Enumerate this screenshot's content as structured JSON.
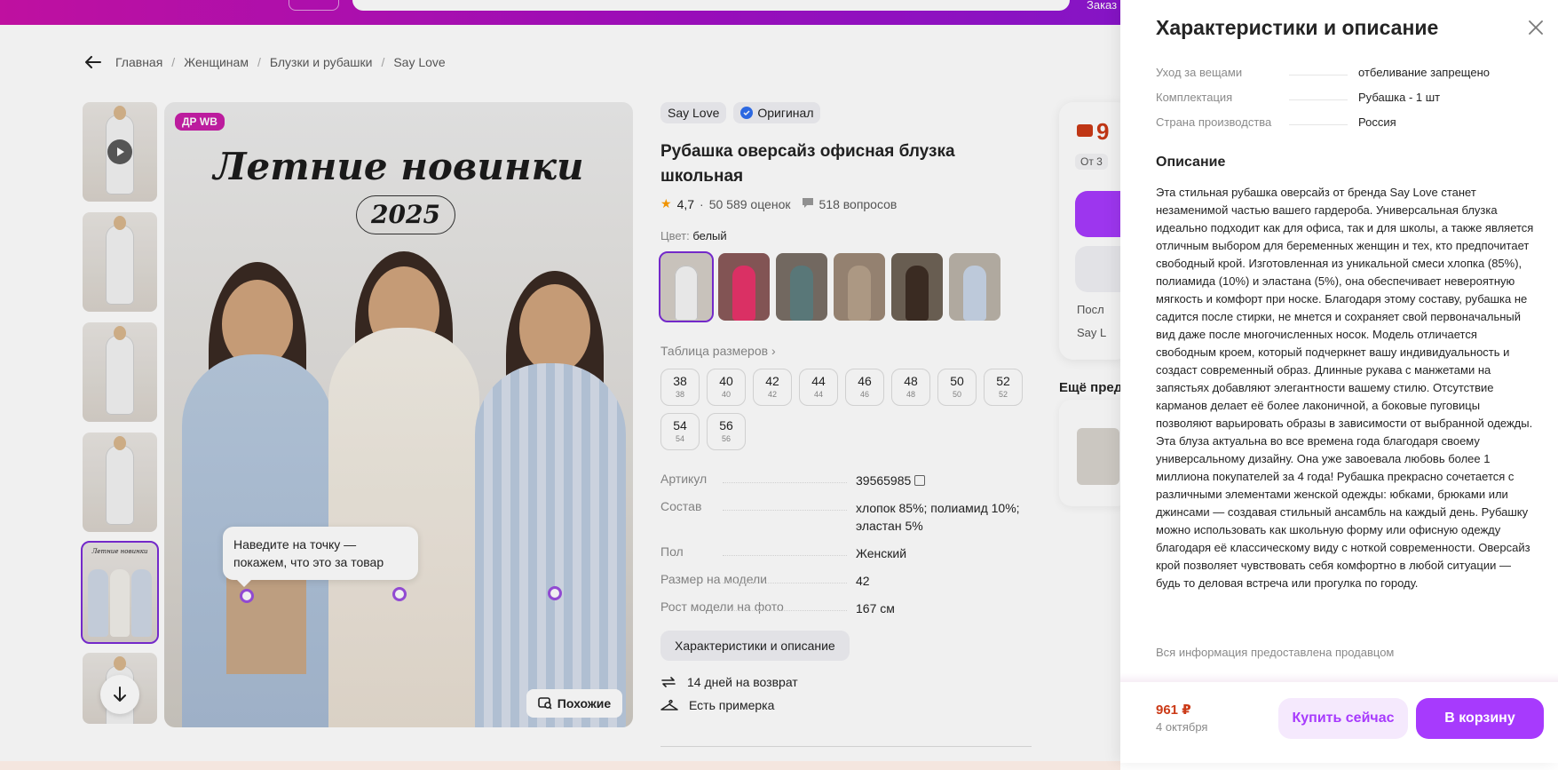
{
  "header": {
    "right_text": "Заказ"
  },
  "breadcrumb": [
    "Главная",
    "Женщинам",
    "Блузки и рубашки",
    "Say Love"
  ],
  "gallery": {
    "badge": "ДР WB",
    "promo_title": "Летние новинки",
    "promo_year": "2025",
    "thumb_mini_title": "Летние новинки",
    "tooltip": "Наведите на точку — покажем, что это за товар",
    "similar_label": "Похожие"
  },
  "product": {
    "brand": "Say Love",
    "original_label": "Оригинал",
    "title": "Рубашка оверсайз офисная блузка школьная",
    "rating": "4,7",
    "rating_sep": "·",
    "reviews": "50 589 оценок",
    "questions": "518 вопросов",
    "color_label": "Цвет:",
    "color_value": "белый",
    "size_table_link": "Таблица размеров",
    "sizes": [
      {
        "main": "38",
        "sub": "38"
      },
      {
        "main": "40",
        "sub": "40"
      },
      {
        "main": "42",
        "sub": "42"
      },
      {
        "main": "44",
        "sub": "44"
      },
      {
        "main": "46",
        "sub": "46"
      },
      {
        "main": "48",
        "sub": "48"
      },
      {
        "main": "50",
        "sub": "50"
      },
      {
        "main": "52",
        "sub": "52"
      },
      {
        "main": "54",
        "sub": "54"
      },
      {
        "main": "56",
        "sub": "56"
      }
    ],
    "specs": [
      {
        "k": "Артикул",
        "v": "39565985"
      },
      {
        "k": "Состав",
        "v": "хлопок 85%; полиамид 10%; эластан 5%"
      },
      {
        "k": "Пол",
        "v": "Женский"
      },
      {
        "k": "Размер на модели",
        "v": "42"
      },
      {
        "k": "Рост модели на фото",
        "v": "167 см"
      }
    ],
    "characteristics_button": "Характеристики и описание",
    "perk_return": "14 дней на возврат",
    "perk_fitting": "Есть примерка"
  },
  "buybox": {
    "price_peek": "9",
    "tag_peek": "От 3",
    "line1_peek": "Посл",
    "line2_peek": "Say L",
    "more_title": "Ещё пред"
  },
  "panel": {
    "title": "Характеристики и описание",
    "rows": [
      {
        "k": "Уход за вещами",
        "v": "отбеливание запрещено"
      },
      {
        "k": "Комплектация",
        "v": "Рубашка - 1 шт"
      },
      {
        "k": "Страна производства",
        "v": "Россия"
      }
    ],
    "description_title": "Описание",
    "description": "Эта стильная рубашка оверсайз от бренда Say Love станет незаменимой частью вашего гардероба. Универсальная блузка идеально подходит как для офиса, так и для школы, а также является отличным выбором для беременных женщин и тех, кто предпочитает свободный крой. Изготовленная из уникальной смеси хлопка (85%), полиамида (10%) и эластана (5%), она обеспечивает невероятную мягкость и комфорт при носке. Благодаря этому составу, рубашка не садится после стирки, не мнется и сохраняет свой первоначальный вид даже после многочисленных носок. Модель отличается свободным кроем, который подчеркнет вашу индивидуальность и создаст современный образ. Длинные рукава с манжетами на запястьях добавляют элегантности вашему стилю. Отсутствие карманов делает её более лаконичной, а боковые пуговицы позволяют варьировать образы в зависимости от выбранной одежды. Эта блуза актуальна во все времена года благодаря своему универсальному дизайну. Она уже завоевала любовь более 1 миллиона покупателей за 4 года! Рубашка прекрасно сочетается с различными элементами женской одежды: юбками, брюками или джинсами — создавая стильный ансамбль на каждый день. Рубашку можно использовать как школьную форму или офисную одежду благодаря её классическому виду с ноткой современности. Оверсайз крой позволяет чувствовать себя комфортно в любой ситуации — будь то деловая встреча или прогулка по городу.",
    "seller_note": "Вся информация предоставлена продавцом",
    "price": "961 ₽",
    "delivery_date": "4 октября",
    "buy_now": "Купить сейчас",
    "add_to_cart": "В корзину"
  },
  "colors": {
    "accent": "#a73afd",
    "price": "#cb3a17",
    "brand_gradient_start": "#cb11ab",
    "brand_gradient_end": "#7a1ee0"
  }
}
